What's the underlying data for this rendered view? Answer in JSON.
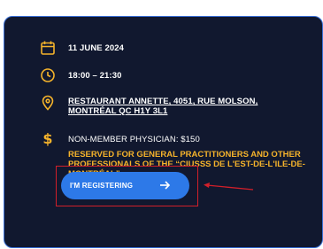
{
  "event": {
    "date": "11 JUNE 2024",
    "time": "18:00 – 21:30",
    "location": "RESTAURANT ANNETTE, 4051, RUE MOLSON, MONTRÉAL QC H1Y 3L1",
    "price_label": "NON-MEMBER PHYSICIAN: $150",
    "price_note": "RESERVED FOR GENERAL PRACTITIONERS AND OTHER PROFESSIONALS OF THE “CIUSSS DE L'EST-DE-L'ILE-DE-MONTRÉAL”.",
    "register_label": "I'M REGISTERING"
  },
  "icons": {
    "date": "calendar-icon",
    "time": "clock-icon",
    "location": "map-pin-icon",
    "price": "dollar-icon",
    "register": "arrow-right-icon"
  },
  "colors": {
    "card_background": "#11182f",
    "card_border": "#3a70d8",
    "accent": "#f5b32b",
    "button": "#2d79e8",
    "annotation": "#d21f2a"
  },
  "dollar_symbol": "$"
}
